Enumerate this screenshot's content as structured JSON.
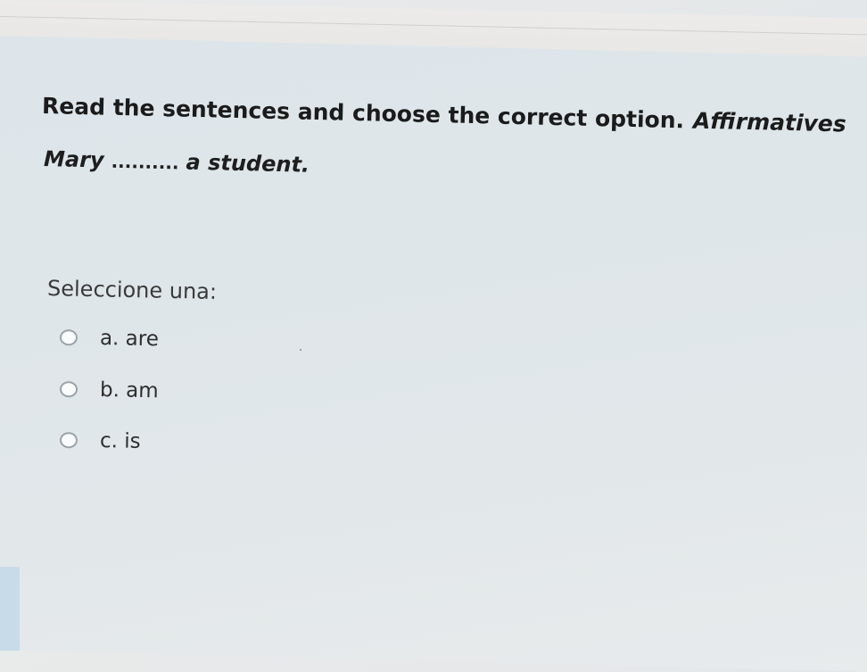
{
  "question": {
    "instruction": "Read the sentences and choose the correct option.",
    "category": "Affirmatives",
    "sentence_start": "Mary",
    "sentence_blank": "..........",
    "sentence_end": "a student."
  },
  "answer_prompt": "Seleccione una:",
  "options": [
    {
      "label": "a. are",
      "selected": false
    },
    {
      "label": "b. am",
      "selected": false
    },
    {
      "label": "c. is",
      "selected": false
    }
  ]
}
